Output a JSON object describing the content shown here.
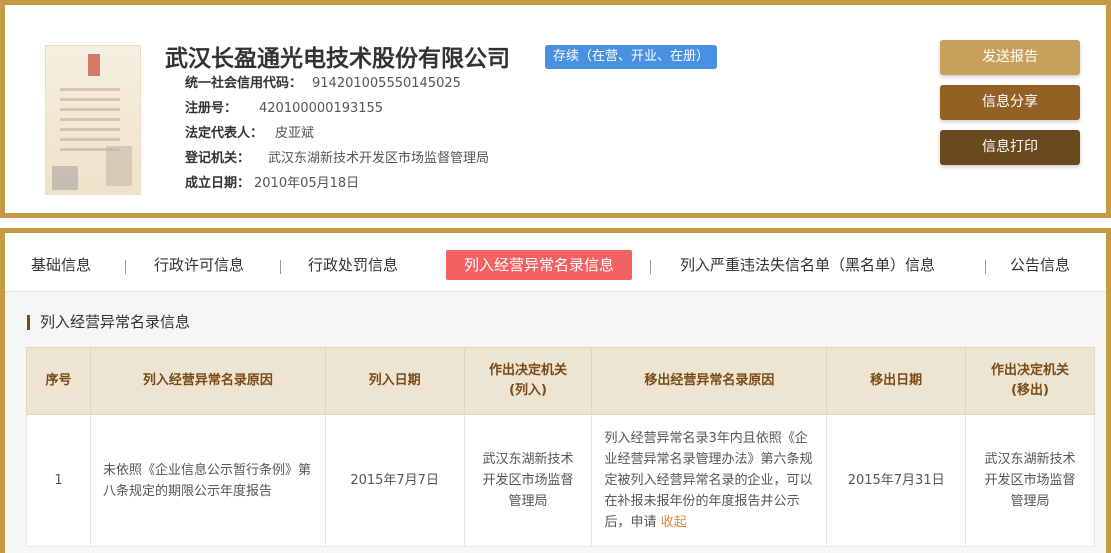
{
  "company": {
    "name": "武汉长盈通光电技术股份有限公司",
    "status": "存续（在营、开业、在册）",
    "fields": [
      {
        "key": "统一社会信用代码：",
        "value": "914201005550145025"
      },
      {
        "key": "注册号：",
        "value": "420100000193155"
      },
      {
        "key": "法定代表人：",
        "value": "皮亚斌"
      },
      {
        "key": "登记机关：",
        "value": "武汉东湖新技术开发区市场监督管理局"
      },
      {
        "key": "成立日期：",
        "value": "2010年05月18日"
      }
    ]
  },
  "actions": {
    "send_report": "发送报告",
    "share": "信息分享",
    "print": "信息打印",
    "colors": {
      "send_report": "#c9a05a",
      "share": "#936124",
      "print": "#6a4a1d"
    }
  },
  "tabs": [
    {
      "label": "基础信息"
    },
    {
      "label": "行政许可信息"
    },
    {
      "label": "行政处罚信息"
    },
    {
      "label": "列入经营异常名录信息",
      "active": true
    },
    {
      "label": "列入严重违法失信名单（黑名单）信息"
    },
    {
      "label": "公告信息"
    }
  ],
  "section": {
    "title": "列入经营异常名录信息",
    "headers": [
      "序号",
      "列入经营异常名录原因",
      "列入日期",
      "作出决定机关\n(列入)",
      "移出经营异常名录原因",
      "移出日期",
      "作出决定机关\n(移出)"
    ],
    "rows": [
      {
        "index": "1",
        "reason_in": "未依照《企业信息公示暂行条例》第八条规定的期限公示年度报告",
        "date_in": "2015年7月7日",
        "authority_in": "武汉东湖新技术开发区市场监督管理局",
        "reason_out": "列入经营异常名录3年内且依照《企业经营异常名录管理办法》第六条规定被列入经营异常名录的企业，可以在补报未报年份的年度报告并公示后，申请",
        "reason_out_link": "收起",
        "date_out": "2015年7月31日",
        "authority_out": "武汉东湖新技术开发区市场监督管理局"
      }
    ]
  },
  "colors": {
    "accent_border": "#c69a45",
    "active_tab": "#f26262",
    "status_badge": "#4a90e2"
  }
}
